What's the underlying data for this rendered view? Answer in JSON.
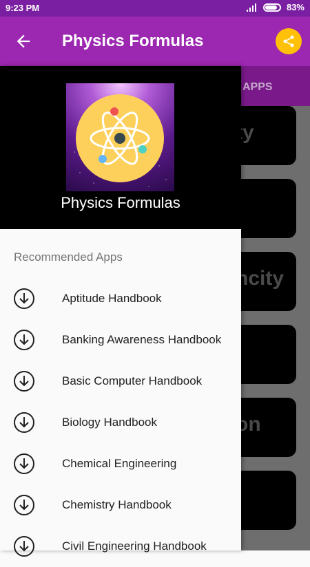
{
  "status": {
    "time": "9:23 PM",
    "battery": "83%",
    "battery_level": 0.83
  },
  "appbar": {
    "title": "Physics Formulas",
    "back_icon": "arrow-back-icon",
    "share_icon": "share-icon"
  },
  "colors": {
    "primary": "#9c27b0",
    "primary_dark": "#7b1fa2",
    "accent": "#ffc107"
  },
  "background_screen": {
    "tab_label": "APPS",
    "cards": [
      "ty",
      "",
      "ncity",
      "",
      "on",
      ""
    ]
  },
  "drawer": {
    "header_title": "Physics Formulas",
    "section_title": "Recommended Apps",
    "items": [
      {
        "label": "Aptitude Handbook",
        "icon": "download-icon"
      },
      {
        "label": "Banking Awareness Handbook",
        "icon": "download-icon"
      },
      {
        "label": "Basic Computer Handbook",
        "icon": "download-icon"
      },
      {
        "label": "Biology Handbook",
        "icon": "download-icon"
      },
      {
        "label": "Chemical Engineering",
        "icon": "download-icon"
      },
      {
        "label": "Chemistry Handbook",
        "icon": "download-icon"
      },
      {
        "label": "Civil Engineering Handbook",
        "icon": "download-icon"
      }
    ]
  }
}
